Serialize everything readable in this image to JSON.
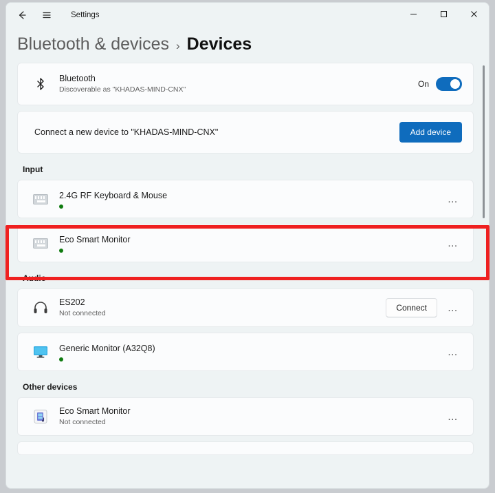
{
  "window": {
    "app_title": "Settings",
    "back_icon": "back-arrow-icon",
    "menu_icon": "hamburger-menu-icon",
    "minimize_label": "–",
    "maximize_label": "☐",
    "close_label": "✕"
  },
  "breadcrumb": {
    "parent": "Bluetooth & devices",
    "separator": "›",
    "current": "Devices"
  },
  "bluetooth": {
    "title": "Bluetooth",
    "subtitle": "Discoverable as \"KHADAS-MIND-CNX\"",
    "toggle_label": "On",
    "toggle_state": "on",
    "accent_color": "#0f6cbd"
  },
  "add_device": {
    "text": "Connect a new device to \"KHADAS-MIND-CNX\"",
    "button_label": "Add device"
  },
  "sections": [
    {
      "title": "Input",
      "devices": [
        {
          "name": "2.4G RF Keyboard & Mouse",
          "status": "connected",
          "status_text": "",
          "icon": "keyboard-icon",
          "more_label": "…",
          "connect_label": ""
        },
        {
          "name": "Eco Smart Monitor",
          "status": "connected",
          "status_text": "",
          "icon": "keyboard-icon",
          "more_label": "…",
          "connect_label": ""
        }
      ]
    },
    {
      "title": "Audio",
      "devices": [
        {
          "name": "ES202",
          "status": "disconnected",
          "status_text": "Not connected",
          "icon": "headphones-icon",
          "more_label": "…",
          "connect_label": "Connect"
        },
        {
          "name": "Generic Monitor (A32Q8)",
          "status": "connected",
          "status_text": "",
          "icon": "monitor-icon",
          "more_label": "…",
          "connect_label": ""
        }
      ]
    },
    {
      "title": "Other devices",
      "devices": [
        {
          "name": "Eco Smart Monitor",
          "status": "disconnected",
          "status_text": "Not connected",
          "icon": "media-device-icon",
          "more_label": "…",
          "connect_label": ""
        }
      ]
    }
  ],
  "annotation": {
    "highlight_color": "#ef2020",
    "target": "Eco Smart Monitor input device card"
  }
}
